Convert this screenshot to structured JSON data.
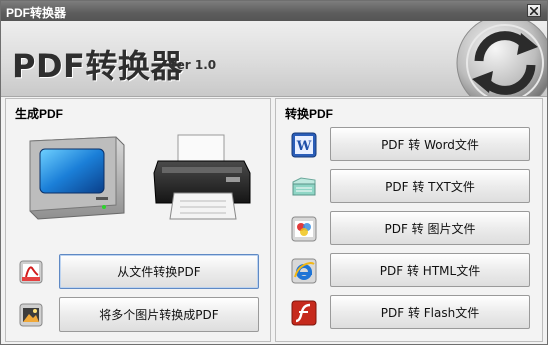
{
  "window": {
    "title": "PDF转换器"
  },
  "header": {
    "app_title": "PDF转换器",
    "version": "Ver 1.0"
  },
  "left_panel": {
    "title": "生成PDF",
    "buttons": [
      {
        "label": "从文件转换PDF",
        "icon": "pdf-file-icon"
      },
      {
        "label": "将多个图片转换成PDF",
        "icon": "image-icon"
      }
    ]
  },
  "right_panel": {
    "title": "转换PDF",
    "buttons": [
      {
        "label": "PDF 转 Word文件",
        "icon": "word-icon"
      },
      {
        "label": "PDF 转 TXT文件",
        "icon": "txt-icon"
      },
      {
        "label": "PDF 转 图片文件",
        "icon": "picture-icon"
      },
      {
        "label": "PDF 转 HTML文件",
        "icon": "ie-icon"
      },
      {
        "label": "PDF 转 Flash文件",
        "icon": "flash-icon"
      }
    ]
  }
}
